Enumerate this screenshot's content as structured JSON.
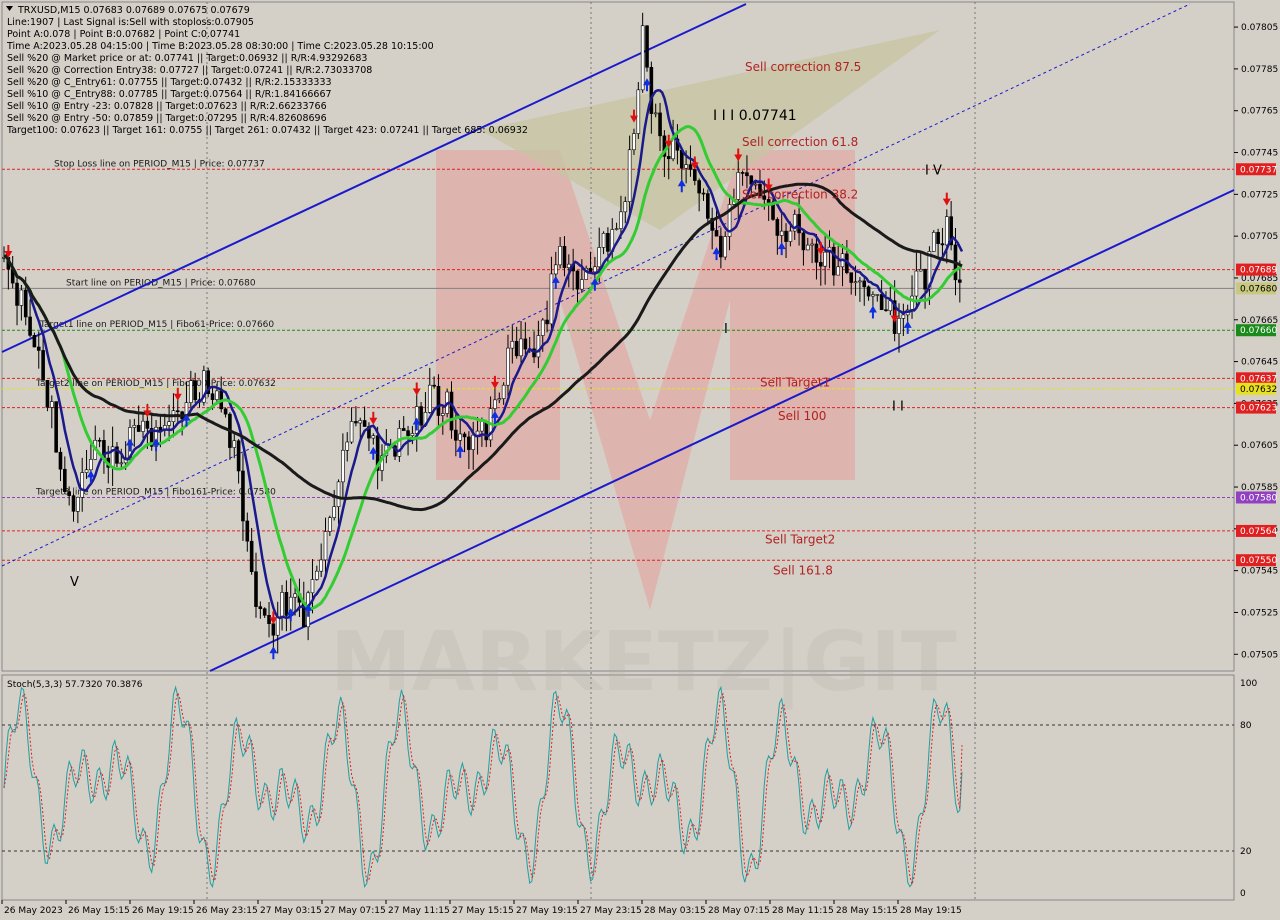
{
  "header": {
    "lines": [
      "TRXUSD,M15  0.07683 0.07689 0.07675 0.07679",
      "Line:1907  | Last Signal is:Sell with stoploss:0.07905",
      "Point A:0.078 | Point B:0.07682 | Point C:0.07741",
      "Time A:2023.05.28 04:15:00  | Time B:2023.05.28 08:30:00  | Time C:2023.05.28 10:15:00",
      "Sell %20 @ Market price or at: 0.07741 ||  Target:0.06932 || R/R:4.93292683",
      "Sell %20 @ Correction Entry38: 0.07727 || Target:0.07241 || R/R:2.73033708",
      "Sell %20 @ C_Entry61: 0.07755 || Target:0.07432 || R/R:2.15333333",
      "Sell %10 @ C_Entry88: 0.07785 || Target:0.07564 || R/R:1.84166667",
      "Sell %10 @ Entry -23: 0.07828 || Target:0.07623 || R/R:2.66233766",
      "Sell %20 @ Entry -50: 0.07859 || Target:0.07295 || R/R:4.82608696",
      "Target100: 0.07623 || Target 161: 0.0755 || Target 261: 0.07432 || Target 423: 0.07241 || Target 685: 0.06932"
    ]
  },
  "price_axis": {
    "ticks": [
      "0.07805",
      "0.07785",
      "0.07765",
      "0.07745",
      "0.07725",
      "0.07705",
      "0.07685",
      "0.07665",
      "0.07645",
      "0.07625",
      "0.07605",
      "0.07585",
      "0.07565",
      "0.07545",
      "0.07525",
      "0.07505"
    ],
    "tags": [
      {
        "text": "0.07737",
        "value": 0.07737,
        "color": "#e02020"
      },
      {
        "text": "0.07689",
        "value": 0.07689,
        "color": "#e02020"
      },
      {
        "text": "0.07680",
        "value": 0.0768,
        "color": "#c8c880"
      },
      {
        "text": "0.07660",
        "value": 0.0766,
        "color": "#1a8a1a"
      },
      {
        "text": "0.07637",
        "value": 0.07637,
        "color": "#e02020"
      },
      {
        "text": "0.07632",
        "value": 0.07632,
        "color": "#e8e020"
      },
      {
        "text": "0.07623",
        "value": 0.07623,
        "color": "#e02020"
      },
      {
        "text": "0.07580",
        "value": 0.0758,
        "color": "#9040c0"
      },
      {
        "text": "0.07564",
        "value": 0.07564,
        "color": "#e02020"
      },
      {
        "text": "0.07550",
        "value": 0.0755,
        "color": "#e02020"
      }
    ]
  },
  "levels": [
    {
      "label": "Stop Loss line on PERIOD_M15 | Price: 0.07737",
      "value": 0.07737,
      "color": "#e02020"
    },
    {
      "label": "",
      "value": 0.07689,
      "color": "#e02020"
    },
    {
      "label": "Start line on PERIOD_M15 | Price: 0.07680",
      "value": 0.0768,
      "color": "#808080"
    },
    {
      "label": "Target1 line on PERIOD_M15 | Fibo61-Price: 0.07660",
      "value": 0.0766,
      "color": "#1a8a1a"
    },
    {
      "label": "Target2 line on PERIOD_M15 | Fibo100-Price: 0.07632",
      "value": 0.07632,
      "color": "#e8e020"
    },
    {
      "label": "",
      "value": 0.07637,
      "color": "#e02020"
    },
    {
      "label": "",
      "value": 0.07623,
      "color": "#e02020"
    },
    {
      "label": "Target3 line on PERIOD_M15 | Fibo161-Price: 0.07580",
      "value": 0.0758,
      "color": "#9040c0"
    },
    {
      "label": "",
      "value": 0.07564,
      "color": "#e02020"
    },
    {
      "label": "",
      "value": 0.0755,
      "color": "#e02020"
    }
  ],
  "annotations": [
    {
      "text": "Sell correction 87.5",
      "value": 0.07786
    },
    {
      "text": "Sell correction 61.8",
      "value": 0.0775
    },
    {
      "text": "Sell correction 38.2",
      "value": 0.07725
    },
    {
      "text": "Sell Target1",
      "value": 0.07635
    },
    {
      "text": "Sell 100",
      "value": 0.07619
    },
    {
      "text": "Sell Target2",
      "value": 0.0756
    },
    {
      "text": "Sell 161.8",
      "value": 0.07545
    }
  ],
  "wave_labels": [
    {
      "text": "I I I  0.07741",
      "value": 0.07763
    },
    {
      "text": "I V",
      "value": 0.07737
    },
    {
      "text": "V",
      "value": 0.0754
    },
    {
      "text": "I",
      "value": 0.07661
    },
    {
      "text": "I I",
      "value": 0.07624
    }
  ],
  "time_axis": [
    "26 May 2023",
    "26 May 15:15",
    "26 May 19:15",
    "26 May 23:15",
    "27 May 03:15",
    "27 May 07:15",
    "27 May 11:15",
    "27 May 15:15",
    "27 May 19:15",
    "27 May 23:15",
    "28 May 03:15",
    "28 May 07:15",
    "28 May 11:15",
    "28 May 15:15",
    "28 May 19:15"
  ],
  "stoch": {
    "label": "Stoch(5,3,3) 57.7320 70.3876",
    "ticks": [
      "100",
      "80",
      "20",
      "0"
    ],
    "levels": [
      80,
      20
    ],
    "main_color": "#20a0a0",
    "signal_color": "#e02020"
  },
  "watermark": {
    "text": "MARKETZ|GIT"
  },
  "colors": {
    "candle": "#000000",
    "ma_fast": "#1a1a8c",
    "ma_mid": "#33cc33",
    "ma_slow": "#1a1a1a",
    "channel": "#1a1acc",
    "bg": "#d4d0c8"
  },
  "chart_data": {
    "type": "candlestick",
    "symbol": "TRXUSD",
    "timeframe": "M15",
    "ylim": [
      0.07497,
      0.07817
    ],
    "last": {
      "open": 0.07683,
      "high": 0.07689,
      "low": 0.07675,
      "close": 0.07679
    },
    "close_path": [
      [
        0,
        0.07695
      ],
      [
        8,
        0.07675
      ],
      [
        15,
        0.07648
      ],
      [
        20,
        0.0763
      ],
      [
        26,
        0.07592
      ],
      [
        30,
        0.07575
      ],
      [
        36,
        0.07588
      ],
      [
        42,
        0.07612
      ],
      [
        48,
        0.07596
      ],
      [
        55,
        0.07602
      ],
      [
        62,
        0.07615
      ],
      [
        70,
        0.0761
      ],
      [
        78,
        0.07615
      ],
      [
        84,
        0.07628
      ],
      [
        92,
        0.07636
      ],
      [
        98,
        0.07629
      ],
      [
        104,
        0.07612
      ],
      [
        108,
        0.0759
      ],
      [
        112,
        0.07562
      ],
      [
        116,
        0.0753
      ],
      [
        120,
        0.0752
      ],
      [
        126,
        0.07525
      ],
      [
        132,
        0.07533
      ],
      [
        138,
        0.07528
      ],
      [
        144,
        0.07545
      ],
      [
        150,
        0.07575
      ],
      [
        156,
        0.076
      ],
      [
        160,
        0.07618
      ],
      [
        166,
        0.07613
      ],
      [
        172,
        0.07596
      ],
      [
        178,
        0.07603
      ],
      [
        184,
        0.07607
      ],
      [
        190,
        0.07615
      ],
      [
        196,
        0.0763
      ],
      [
        202,
        0.07624
      ],
      [
        208,
        0.07615
      ],
      [
        214,
        0.07605
      ],
      [
        220,
        0.07612
      ],
      [
        226,
        0.07625
      ],
      [
        232,
        0.07648
      ],
      [
        238,
        0.07655
      ],
      [
        244,
        0.07648
      ],
      [
        250,
        0.0767
      ],
      [
        256,
        0.077
      ],
      [
        262,
        0.07688
      ],
      [
        268,
        0.07682
      ],
      [
        274,
        0.077
      ],
      [
        280,
        0.07705
      ],
      [
        286,
        0.07722
      ],
      [
        290,
        0.0776
      ],
      [
        294,
        0.078
      ],
      [
        298,
        0.07768
      ],
      [
        302,
        0.07752
      ],
      [
        308,
        0.07745
      ],
      [
        314,
        0.0774
      ],
      [
        320,
        0.07728
      ],
      [
        326,
        0.07712
      ],
      [
        330,
        0.07696
      ],
      [
        334,
        0.07718
      ],
      [
        340,
        0.07735
      ],
      [
        346,
        0.0773
      ],
      [
        352,
        0.07718
      ],
      [
        358,
        0.07708
      ],
      [
        364,
        0.07712
      ],
      [
        370,
        0.07705
      ],
      [
        376,
        0.07696
      ],
      [
        382,
        0.07692
      ],
      [
        388,
        0.07688
      ],
      [
        394,
        0.07683
      ],
      [
        400,
        0.07678
      ],
      [
        406,
        0.07672
      ],
      [
        412,
        0.07666
      ],
      [
        418,
        0.07676
      ],
      [
        424,
        0.07686
      ],
      [
        430,
        0.07705
      ],
      [
        434,
        0.0771
      ],
      [
        438,
        0.07693
      ],
      [
        441,
        0.07679
      ]
    ],
    "overlays": [
      {
        "name": "",
        "type": "moving_average",
        "color": "#1a1a8c"
      },
      {
        "name": "",
        "type": "moving_average",
        "color": "#33cc33"
      },
      {
        "name": "",
        "type": "moving_average",
        "color": "#1a1a1a"
      }
    ],
    "xlabel": "",
    "ylabel": ""
  }
}
